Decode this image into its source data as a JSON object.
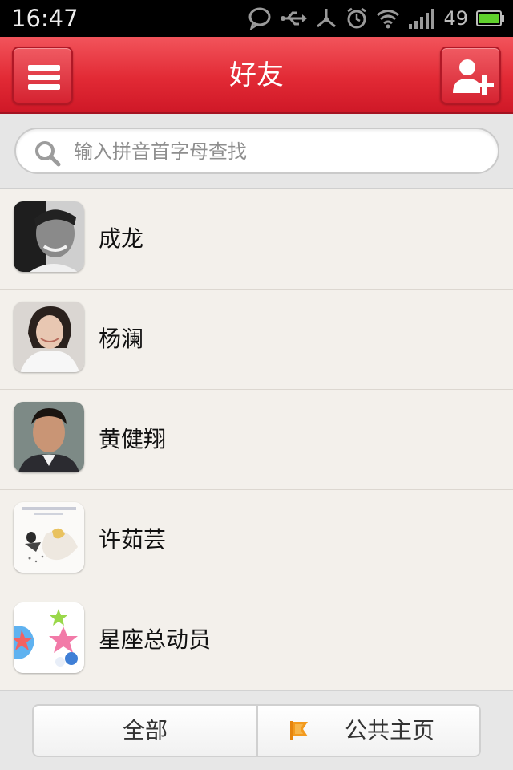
{
  "status_bar": {
    "time": "16:47",
    "battery_level": "49",
    "icons": [
      "chat-bubble-icon",
      "usb-icon",
      "tether-icon",
      "alarm-icon",
      "wifi-icon",
      "signal-icon",
      "battery-icon"
    ]
  },
  "header": {
    "title": "好友",
    "menu_icon": "hamburger-menu-icon",
    "add_icon": "add-friend-icon"
  },
  "search": {
    "placeholder": "输入拼音首字母查找",
    "value": ""
  },
  "friends": [
    {
      "name": "成龙",
      "avatar": "portrait-photo"
    },
    {
      "name": "杨澜",
      "avatar": "portrait-photo"
    },
    {
      "name": "黄健翔",
      "avatar": "portrait-photo"
    },
    {
      "name": "许茹芸",
      "avatar": "album-cover-image"
    },
    {
      "name": "星座总动员",
      "avatar": "stars-cartoon-image"
    }
  ],
  "bottom_tabs": {
    "all_label": "全部",
    "public_label": "公共主页",
    "public_icon": "flag-icon"
  },
  "colors": {
    "header_red": "#e22a35",
    "flag_orange": "#f39a1e"
  }
}
